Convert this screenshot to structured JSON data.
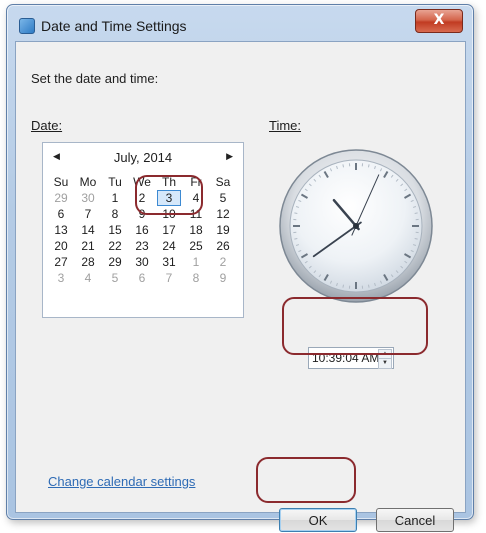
{
  "window": {
    "title": "Date and Time Settings",
    "close_label": "X"
  },
  "instruction": "Set the date and time:",
  "date_label": "Date:",
  "time_label": "Time:",
  "calendar": {
    "month_label": "July, 2014",
    "prev_arrow": "◀",
    "next_arrow": "▶",
    "weekdays": [
      "Su",
      "Mo",
      "Tu",
      "We",
      "Th",
      "Fr",
      "Sa"
    ],
    "weeks": [
      [
        "29",
        "30",
        "1",
        "2",
        "3",
        "4",
        "5"
      ],
      [
        "6",
        "7",
        "8",
        "9",
        "10",
        "11",
        "12"
      ],
      [
        "13",
        "14",
        "15",
        "16",
        "17",
        "18",
        "19"
      ],
      [
        "20",
        "21",
        "22",
        "23",
        "24",
        "25",
        "26"
      ],
      [
        "27",
        "28",
        "29",
        "30",
        "31",
        "1",
        "2"
      ],
      [
        "3",
        "4",
        "5",
        "6",
        "7",
        "8",
        "9"
      ]
    ],
    "selected_day": "3"
  },
  "clock": {
    "hour": 10,
    "minute": 39,
    "second": 4
  },
  "time_value": "10:39:04 AM",
  "spin_up": "▲",
  "spin_down": "▼",
  "change_calendar_link": "Change calendar settings",
  "buttons": {
    "ok": "OK",
    "cancel": "Cancel"
  },
  "colors": {
    "annotation": "#8b2a2e",
    "link": "#2e6bb5",
    "selection": "#3d8ad2"
  }
}
